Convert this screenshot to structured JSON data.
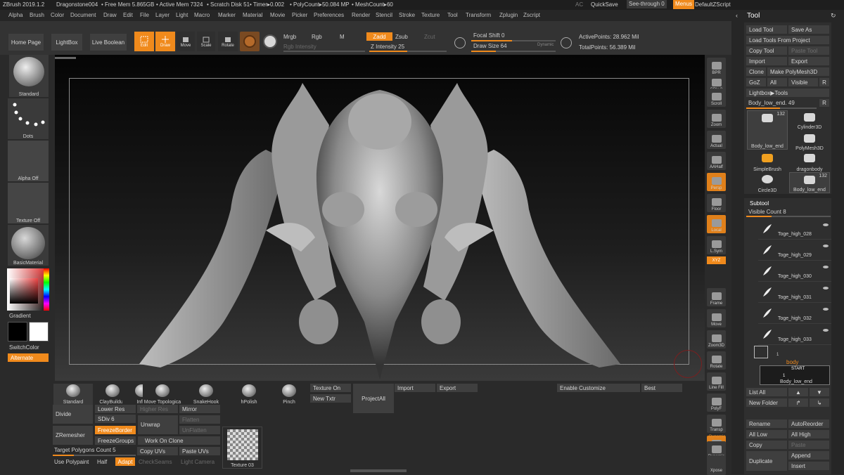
{
  "titlebar": {
    "app": "ZBrush 2019.1.2",
    "file": "Dragonstone004",
    "freemem": "• Free Mem 5.865GB",
    "activemem": "• Active Mem 7324",
    "scratch": "• Scratch Disk 51",
    "timer": "• Timer▸0.002",
    "polycount": "• PolyCount▸50.084 MP",
    "meshcount": "• MeshCount▸60",
    "ac": "AC",
    "quicksave": "QuickSave",
    "seethrough": "See-through  0",
    "menus": "Menus",
    "defaultscript": "DefaultZScript"
  },
  "menubar": [
    "Alpha",
    "Brush",
    "Color",
    "Document",
    "Draw",
    "Edit",
    "File",
    "Layer",
    "Light",
    "Macro",
    "Marker",
    "Material",
    "Movie",
    "Picker",
    "Preferences",
    "Render",
    "Stencil",
    "Stroke",
    "Texture",
    "Tool",
    "Transform",
    "Zplugin",
    "Zscript"
  ],
  "shelf": {
    "home": "Home Page",
    "lightbox": "LightBox",
    "liveboolean": "Live Boolean",
    "edit": "Edit",
    "draw": "Draw",
    "move": "Move",
    "scale": "Scale",
    "rotate": "Rotate",
    "mrgb": "Mrgb",
    "rgb": "Rgb",
    "m": "M",
    "rgbintensity": "Rgb Intensity",
    "zadd": "Zadd",
    "zsub": "Zsub",
    "zcut": "Zcut",
    "zintensity": "Z Intensity 25",
    "focal": "Focal Shift 0",
    "drawsize": "Draw Size 64",
    "dynamic": "Dynamic",
    "active": "ActivePoints: 28.962 Mil",
    "total": "TotalPoints: 56.389 Mil"
  },
  "leftshelf": {
    "standard": "Standard",
    "dots": "Dots",
    "alphaoff": "Alpha Off",
    "textureoff": "Texture Off",
    "basicmaterial": "BasicMaterial",
    "gradient": "Gradient",
    "switchcolor": "SwitchColor",
    "alternate": "Alternate"
  },
  "rightshelf": [
    "BPR",
    "SPix 3",
    "Scroll",
    "Zoom",
    "Actual",
    "AAHalf",
    "Persp",
    "Floor",
    "Local",
    "L.Sym",
    "Frame",
    "Move",
    "Zoom3D",
    "Rotate",
    "Line Fill",
    "PolyF",
    "Transp",
    "Ghost",
    "Dynamic",
    "Solo",
    "Xpose"
  ],
  "rightshelf_labels": {
    "dynamic": "Dynamic",
    "xyz": "XYZ"
  },
  "bottom": {
    "brushes": [
      "Standard",
      "ClayBuildup",
      "Inflat",
      "Move Topologica",
      "SnakeHook",
      "hPolish",
      "Pinch"
    ],
    "textureon": "Texture On",
    "newtxtr": "New Txtr",
    "projectall": "ProjectAll",
    "import": "Import",
    "export": "Export",
    "enablecustomize": "Enable Customize",
    "best": "Best",
    "divide": "Divide",
    "lowerres": "Lower Res",
    "higherres": "Higher Res",
    "sdiv": "SDiv 6",
    "mirror": "Mirror",
    "flatten": "Flatten",
    "unwrap": "Unwrap",
    "unflatten": "UnFlatten",
    "zremesher": "ZRemesher",
    "freezeborder": "FreezeBorder",
    "freezegroups": "FreezeGroups",
    "workonclone": "Work On Clone",
    "targetpoly": "Target Polygons Count 5",
    "copyuvs": "Copy UVs",
    "pasteuvs": "Paste UVs",
    "usepolypaint": "Use Polypaint",
    "half": "Half",
    "adapt": "Adapt",
    "checkseams": "CheckSeams",
    "lightcamera": "Light Camera",
    "texture03": "Texture 03"
  },
  "toolpanel": {
    "title": "Tool",
    "loadtool": "Load Tool",
    "saveas": "Save As",
    "loadproject": "Load Tools From Project",
    "copytool": "Copy Tool",
    "pastetool": "Paste Tool",
    "import": "Import",
    "export": "Export",
    "clone": "Clone",
    "makepolymesh": "Make PolyMesh3D",
    "goz": "GoZ",
    "all": "All",
    "visible": "Visible",
    "r": "R",
    "lightboxtools": "Lightbox▶Tools",
    "bodylowend": "Body_low_end. 49",
    "tools": [
      {
        "name": "Body_low_end",
        "count": "132"
      },
      {
        "name": "Cylinder3D"
      },
      {
        "name": "PolyMesh3D"
      },
      {
        "name": "SimpleBrush"
      },
      {
        "name": "dragonbody"
      },
      {
        "name": "Circle3D"
      },
      {
        "name": "Body_low_end",
        "count": "132"
      }
    ],
    "subtool": "Subtool",
    "visiblecount": "Visible Count 8",
    "subtools": [
      "Toge_high_028",
      "Toge_high_029",
      "Toge_high_030",
      "Toge_high_031",
      "Toge_high_032",
      "Toge_high_033"
    ],
    "folder_count": "1",
    "folder": "body",
    "start": "START",
    "start_count": "1",
    "bodyitem": "Body_low_end",
    "listall": "List All",
    "newfolder": "New Folder",
    "rename": "Rename",
    "autoreorder": "AutoReorder",
    "alllow": "All Low",
    "allhigh": "All High",
    "copy": "Copy",
    "paste": "Paste",
    "append": "Append",
    "duplicate": "Duplicate",
    "insert": "Insert"
  },
  "colors": {
    "accent": "#f08a1c",
    "panel": "#3f3f3f",
    "bg": "#2c2c2c"
  }
}
